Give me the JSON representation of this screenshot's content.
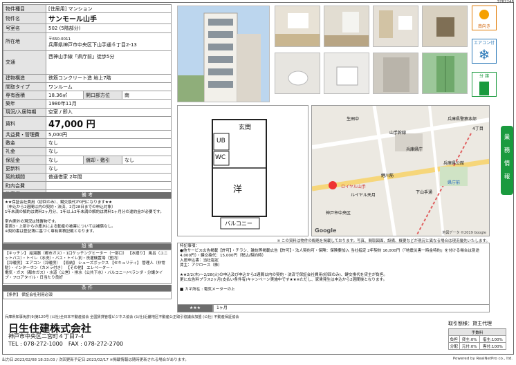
{
  "doc_id": "3782248",
  "spec": {
    "type_label": "物件種目",
    "type_value": "[住居用] マンション",
    "name_label": "物件名",
    "name_value": "サンモール山手",
    "room_label": "号室名",
    "room_value": "502 (5階部分)",
    "address_label": "所在地",
    "address_zip": "〒650-0011",
    "address_value": "兵庫県神戸市中央区下山手通６丁目2-13",
    "traffic_label": "交通",
    "traffic_value": "西神山手線「県庁前」徒歩5分",
    "structure_label": "建物構造",
    "structure_value": "鉄筋コンクリート造 地上7階",
    "layout_label": "間取タイプ",
    "layout_value": "ワンルーム",
    "area_label": "専有面積",
    "area_value": "18.36㎡",
    "opening_label": "開口部方位",
    "opening_value": "南",
    "built_label": "築年",
    "built_value": "1980年11月",
    "status_label": "現況/入居時期",
    "status_value": "空室 / 即入",
    "rent_label": "賃料",
    "rent_value": "47,000 円",
    "fee_label": "共益費・管理費",
    "fee_value": "5,000円",
    "deposit_label": "敷金",
    "deposit_value": "なし",
    "key_label": "礼金",
    "key_value": "なし",
    "guarantee_label": "保証金",
    "guarantee_value": "なし",
    "amort_label": "償却・敷引",
    "amort_value": "なし",
    "renewal_label": "更新料",
    "renewal_value": "なし",
    "contract_label": "契約期間",
    "contract_value": "普通借家 2年間",
    "town_label": "町内会費",
    "town_value": "",
    "parking_label": "駐車場",
    "parking_value": ""
  },
  "remarks_head": "備 考",
  "remarks_lines": [
    "★★保証会社費用（初回のみ）、鍵交換代が0円になります★★",
    "（申込から2週間以内の契約・決済、2月28日までの申込対象）",
    "1年未満の解約は賃料2ヶ月分、1年以上2年未満の解約は賃料1ヶ月分の違約金が必要です。",
    "",
    "室内実外の現況は残置物です。",
    "南面3・上部からの塵水による動産の被害については補償なし。",
    "※契約書は登記簿に基づく専有面積記載となります。"
  ],
  "facilities_head": "設 備",
  "facilities_lines": [
    "【キッチン】 給湯器（都市ガス）・1口ケッチングヒーター（一部口） 【水廻り】 風呂（ユニットバス）・トイレ（水洗）・バス・トイレ別・洗濯機置場（室内）",
    "【冷暖房】 エアコン（冷暖房） 【収納】 シューズボックス 【セキュリティ】 管理人（非常駐）・インターホン（カメラ付き） 【その他】 エレベーター・",
    "電気・ガス（都市ガス）・水道（公営）・排水（公共下水）・バルコニー/ベランダ・分譲タイプ・フロアタイル・日当たり良好"
  ],
  "conditions_head": "条 件",
  "conditions_value": "【条件】 保証会社利用必須",
  "tiles": [
    "南向き",
    "エアコン付",
    "分 譲"
  ],
  "side_tab": [
    "業",
    "務",
    "情",
    "報"
  ],
  "floor": {
    "entrance": "玄関",
    "ub": "UB",
    "wc": "WC",
    "room": "洋",
    "balcony": "バルコニー"
  },
  "map": {
    "labels": [
      "兵庫県警察本部",
      "山手幹線",
      "兵庫県公館",
      "兵庫県庁",
      "県庁前",
      "ロイヤル山手",
      "ルイヤル天月",
      "下山手通",
      "鯉川筋",
      "4丁目",
      "生田中",
      "神戸市中央区"
    ],
    "attribution": "地図データ ©2019 Google",
    "logo": "Google"
  },
  "notice": "※ この資料は物件の概略を掲載しております。写真、間取図面、設備、概要などが現況と異なる場合は現況優先いたします。",
  "remarks2_label": "特記事項：",
  "remarks2_lines": [
    "●他サービス広告掲載【許可】・チラシ、雑誌等掲載広告【許可】・法人契約可・保険：保険要加入 当社指定 2年契約 16,000円（「地震災害一時金特約」を付ける場合は別途4,000円）・鍵交換代：15,000円（税込/契約時）",
    "入居申込書：当社指定",
    "賃主：アクロース（株）",
    "",
    "★★2/2(木)～2/28(火)の申込及び申込から2週間以内の契約・決済で保証会社費用(初回のみ)、鍵交換代を貸主が負担。",
    "更に広告料プラス2ヶ月(支払い条件有)キャンペーン実施中です★★※ただし、家賃発生は申込から2週間後となります。",
    "",
    "■ カギ所在 : 電気メーターの上"
  ],
  "stars": "★★★",
  "stars_value": "1ヶ月",
  "assoc": "兵庫県知事免許(9)第120号 (公社)全日本不動産協会 全国賃貸管理ビジネス協会 (公社)近畿地区不動産公正取引協議会加盟 (公社) 不動産保証協会",
  "company": "日生住建株式会社",
  "company_addr": "神戸市中央区二宮町４丁目7-4",
  "company_tel": "TEL : 078-272-1000　FAX : 078-272-2700",
  "agent": {
    "title": "取引態様：貸主代理",
    "fee_head": "手数料",
    "rows": [
      [
        "負担",
        "貸主:0%",
        "借主:100%"
      ],
      [
        "分配",
        "元付:0%",
        "客付:100%"
      ]
    ]
  },
  "footer_left": "出力日:2023/02/08 18:33:03 / 次回更新予定日:2023/02/17 ※掲載情報は随時更新される場合があります。",
  "footer_right": "Powered by RealNetPro co., ltd."
}
